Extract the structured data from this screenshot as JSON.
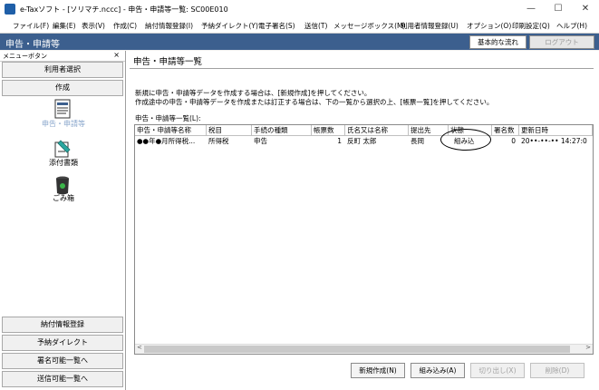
{
  "window": {
    "title": "e-Taxソフト - [ソリマチ.nccc] - 申告・申請等一覧: SC00E010",
    "controls": {
      "minimize": "—",
      "maximize": "☐",
      "close": "✕"
    }
  },
  "menu": [
    "ファイル(F)",
    "編集(E)",
    "表示(V)",
    "作成(C)",
    "納付情報登録(I)",
    "予納ダイレクト(Y)",
    "電子署名(S)",
    "送信(T)",
    "メッセージボックス(M)",
    "利用者情報登録(U)",
    "オプション(O)",
    "印刷設定(Q)",
    "ヘルプ(H)"
  ],
  "header": {
    "title": "申告・申請等",
    "flow_button": "基本的な流れ",
    "logout_button": "ログアウト"
  },
  "sidebar": {
    "menu_label": "メニューボタン",
    "close": "×",
    "user_select": "利用者選択",
    "create": "作成",
    "icons": [
      {
        "label": "申告・申請等",
        "icon": "document-icon"
      },
      {
        "label": "添付書類",
        "icon": "attachment-icon"
      },
      {
        "label": "ごみ箱",
        "icon": "trash-icon"
      }
    ],
    "bottom_buttons": [
      "納付情報登録",
      "予納ダイレクト",
      "署名可能一覧へ",
      "送信可能一覧へ"
    ]
  },
  "main": {
    "title": "申告・申請等一覧",
    "instructions": [
      "新規に申告・申請等データを作成する場合は、[新規作成]を押してください。",
      "作成途中の申告・申請等データを作成または訂正する場合は、下の一覧から選択の上、[帳票一覧]を押してください。"
    ],
    "list_label": "申告・申請等一覧(L):",
    "columns": [
      "申告・申請等名称",
      "税目",
      "手続の種類",
      "帳票数",
      "氏名又は名称",
      "提出先",
      "状態",
      "署名数",
      "更新日時"
    ],
    "rows": [
      [
        "●●年●月所得税...",
        "所得税",
        "申告",
        "1",
        "反町 太郎",
        "長岡",
        "組み込",
        "0",
        "20••-••-•• 14:27:0"
      ]
    ],
    "buttons": {
      "new": "新規作成(N)",
      "import": "組み込み(A)",
      "export": "切り出し(X)",
      "delete": "削除(D)"
    }
  },
  "colors": {
    "header_bg": "#3c5f8e",
    "selection": "#d9e6f6"
  }
}
